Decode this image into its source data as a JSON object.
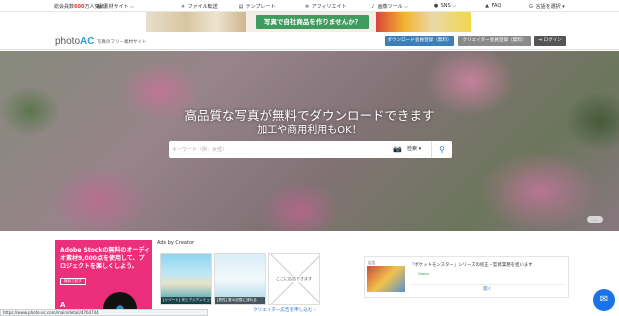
{
  "topnav": {
    "members_prefix": "総会員数",
    "members_count": "600",
    "members_suffix": "万人突破！",
    "items": [
      {
        "icon": "grid-icon",
        "glyph": "▦",
        "label": "素材サイト",
        "chevron": "⌵"
      },
      {
        "icon": "file-transfer-icon",
        "glyph": "✈",
        "label": "ファイル転送"
      },
      {
        "icon": "template-icon",
        "glyph": "▤",
        "label": "テンプレート"
      },
      {
        "icon": "affiliate-icon",
        "glyph": "✲",
        "label": "アフィリエイト"
      },
      {
        "icon": "image-tool-icon",
        "glyph": "♪",
        "label": "画像ツール",
        "chevron": "⌵"
      },
      {
        "icon": "sns-icon",
        "glyph": "●",
        "label": "SNS",
        "chevron": "⌵"
      },
      {
        "icon": "faq-icon",
        "glyph": "▲",
        "label": "FAQ"
      },
      {
        "icon": "language-icon",
        "glyph": "G",
        "label": "言語を選択",
        "chevron": "▾"
      }
    ]
  },
  "promo": {
    "text": "写真で自社商品を作りませんか？"
  },
  "header": {
    "logo_text": "photo",
    "logo_accent": "AC",
    "tagline": "写真のフリー素材サイト",
    "free_register": "ダウンロード会員登録（無料）",
    "creator_register": "クリエイター会員登録（無料）",
    "login": "ログイン",
    "login_icon": "⇥"
  },
  "hero": {
    "headline": "高品質な写真が無料でダウンロードできます",
    "subheadline": "加工や商用利用もOK！",
    "search_placeholder": "キーワード（例：女性）",
    "camera_glyph": "📷",
    "select_value": "检索",
    "select_chevron": "▾",
    "search_glyph": "⚲",
    "credit": "..."
  },
  "ad_left": {
    "text": "Adobe Stockの無料のオーディオ素材9,000点を使用して、プロジェクトを楽しくしよう。",
    "button": "無料で試す",
    "logo": "A"
  },
  "ads_by_creator": {
    "title": "Ads by Creator",
    "items": [
      {
        "caption": "[リゾート] 光とアジアンミュージック"
      },
      {
        "caption": "[男性] 夏の記憶に浸れる"
      },
      {
        "caption": "ここに広告できます"
      }
    ],
    "link": "クリエイター広告を申し込む ›"
  },
  "ad_right": {
    "tag": "広告",
    "text": "「ポケットモンスター」シリーズの校正・監修業務を担います",
    "source": "Green",
    "cta": "開く"
  },
  "status_url": "https://www.photo-ac.com/main/detail/4764744",
  "messenger_glyph": "✉"
}
